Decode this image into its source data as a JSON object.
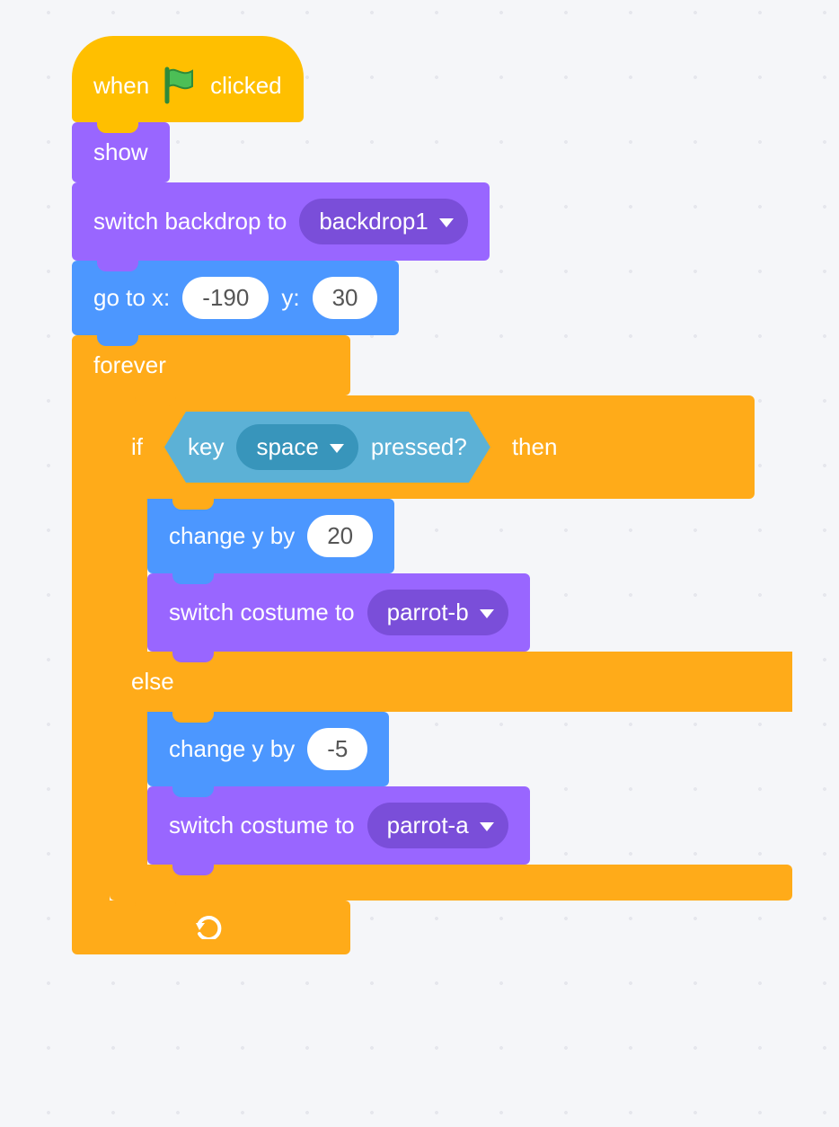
{
  "colors": {
    "events": "#ffbf00",
    "looks": "#9966ff",
    "motion": "#4c97ff",
    "control": "#ffab19",
    "sensing": "#5cb1d6"
  },
  "hat": {
    "when": "when",
    "clicked": "clicked",
    "icon": "green-flag-icon"
  },
  "blocks": {
    "show": "show",
    "switch_backdrop": {
      "label": "switch backdrop to",
      "value": "backdrop1"
    },
    "goto": {
      "label_x": "go to x:",
      "x": "-190",
      "label_y": "y:",
      "y": "30"
    },
    "forever": "forever",
    "if": "if",
    "then": "then",
    "else": "else",
    "key_pressed": {
      "key_label": "key",
      "key_value": "space",
      "pressed_label": "pressed?"
    },
    "change_y_if": {
      "label": "change y by",
      "value": "20"
    },
    "switch_costume_if": {
      "label": "switch costume to",
      "value": "parrot-b"
    },
    "change_y_else": {
      "label": "change y by",
      "value": "-5"
    },
    "switch_costume_else": {
      "label": "switch costume to",
      "value": "parrot-a"
    }
  }
}
